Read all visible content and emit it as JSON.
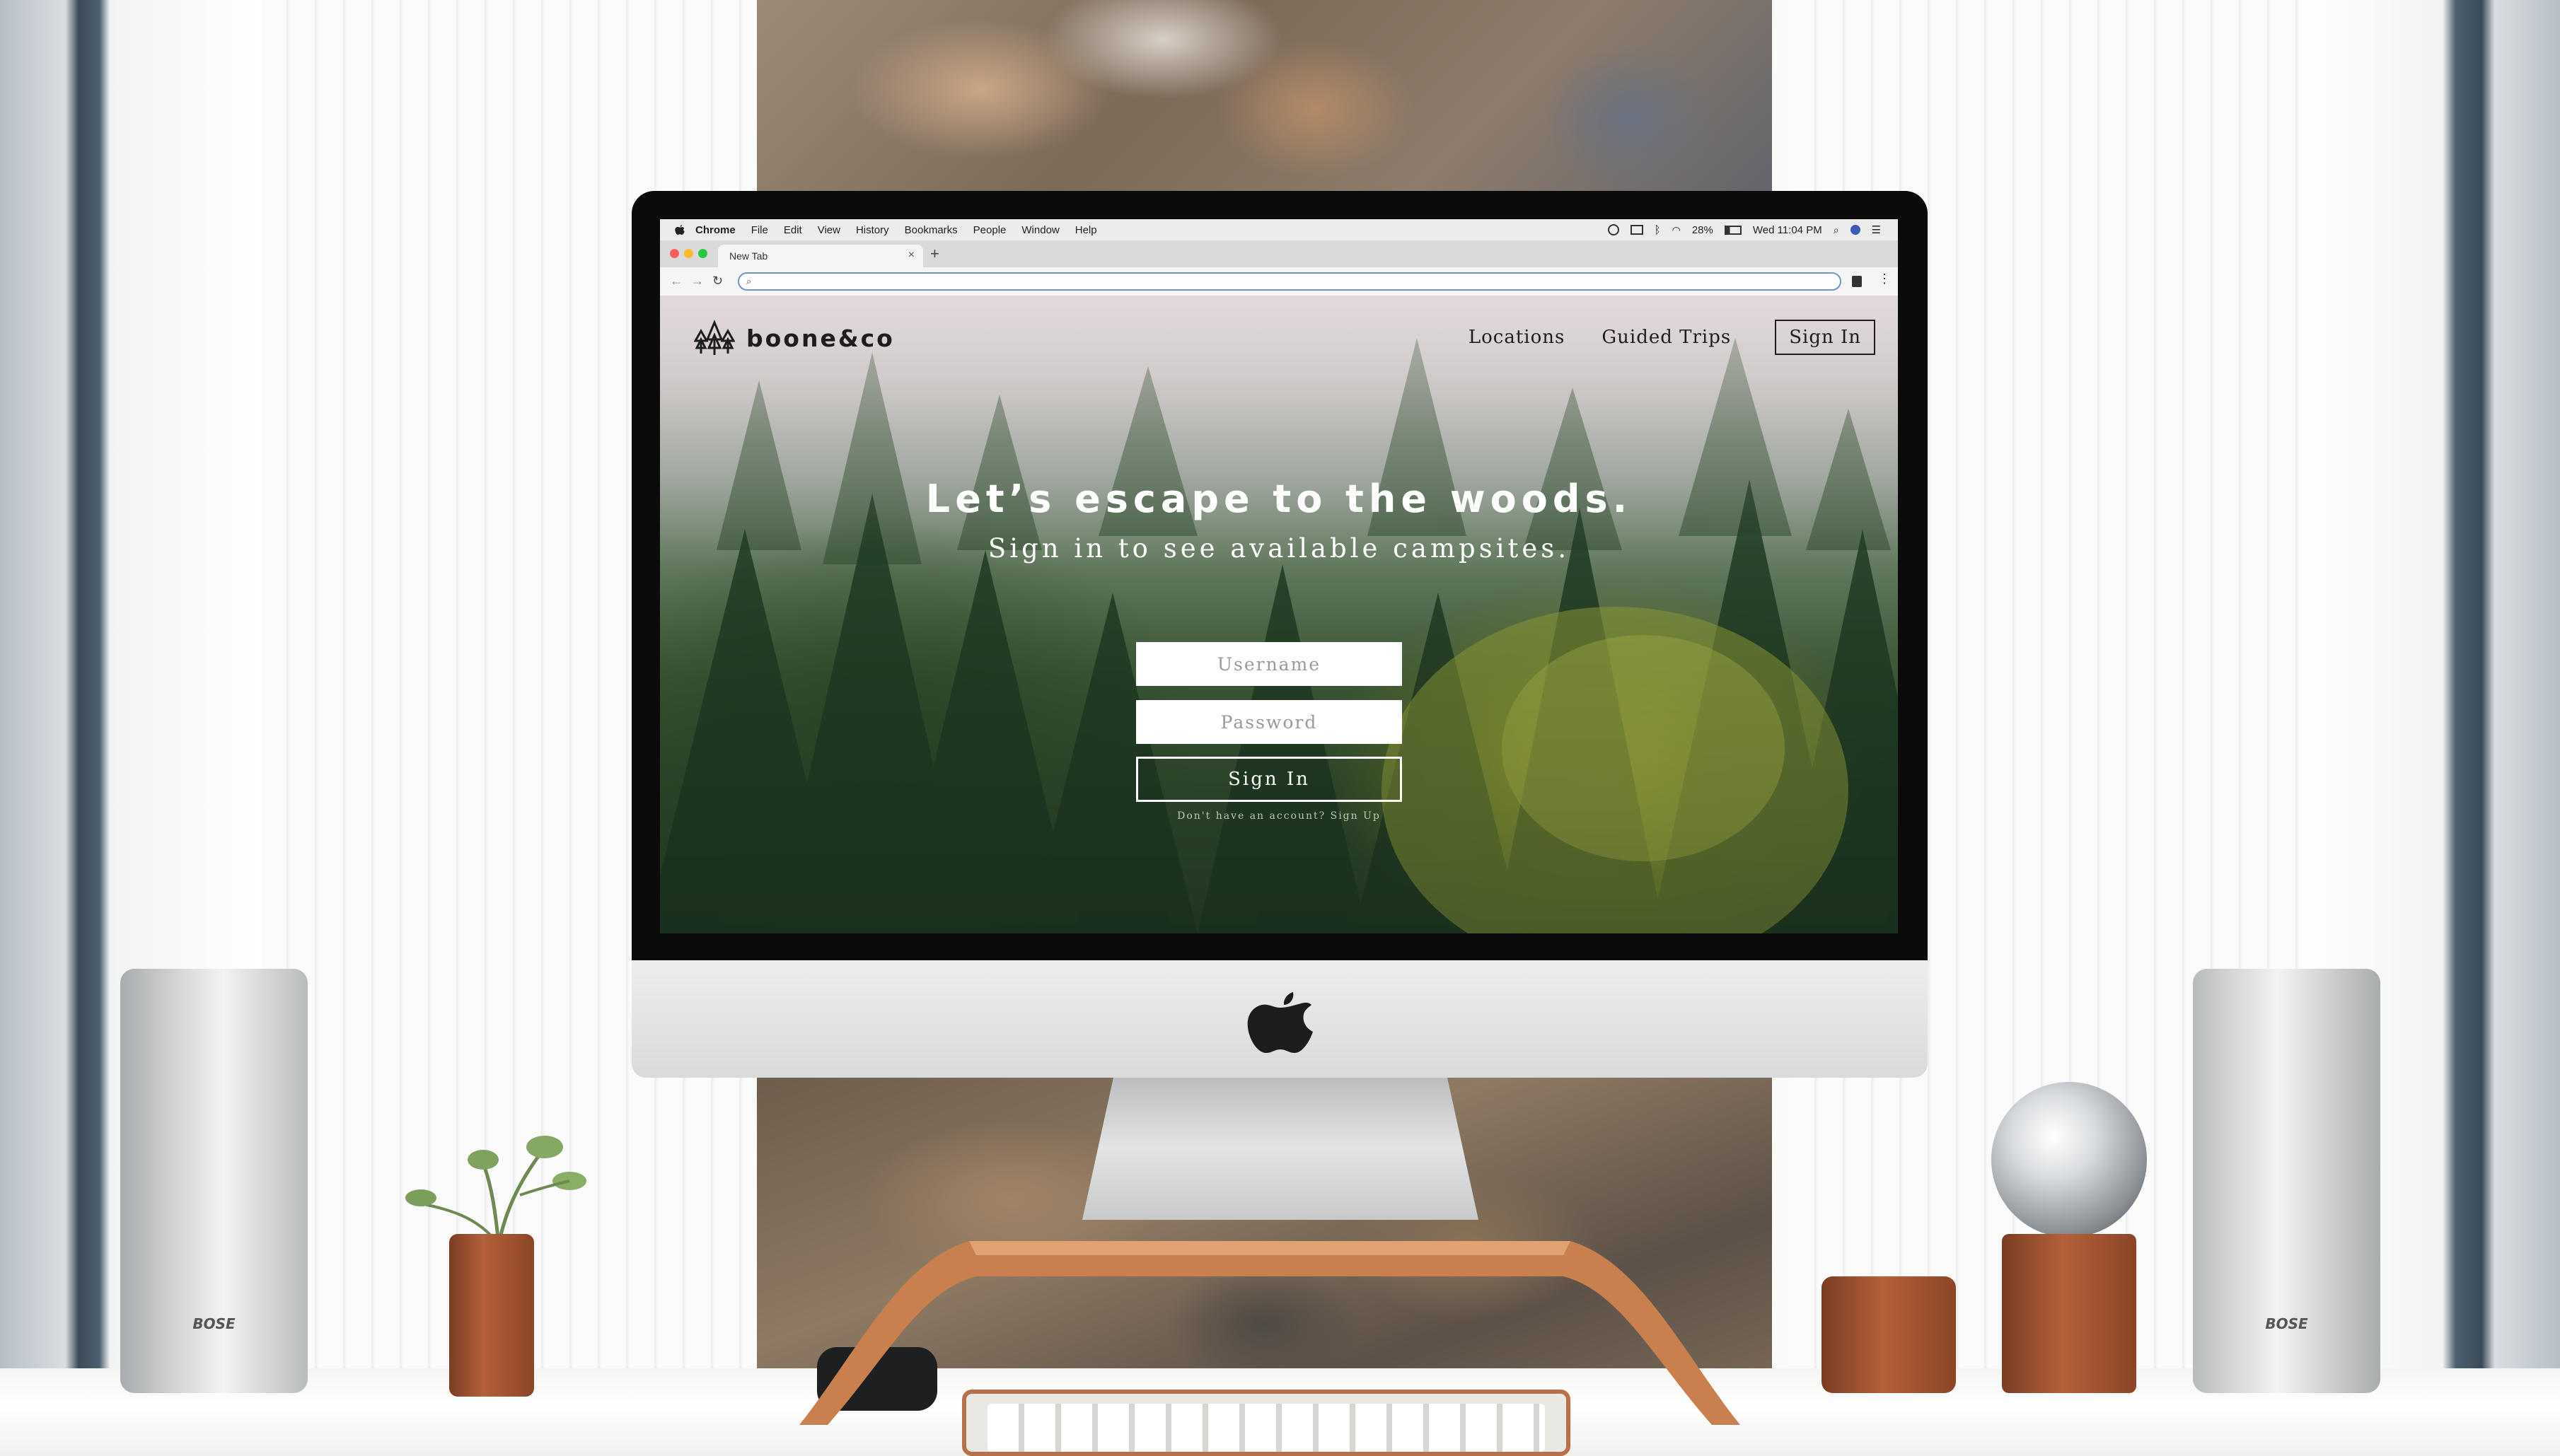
{
  "menubar": {
    "items": [
      "Chrome",
      "File",
      "Edit",
      "View",
      "History",
      "Bookmarks",
      "People",
      "Window",
      "Help"
    ],
    "battery": "28%",
    "clock": "Wed 11:04 PM"
  },
  "browser": {
    "tab_title": "New Tab",
    "tab_close": "×",
    "new_tab": "+",
    "omnibox_value": "",
    "omnibox_icon": "search-icon"
  },
  "site": {
    "brand": "boone&co",
    "nav": {
      "locations": "Locations",
      "guided_trips": "Guided Trips",
      "sign_in": "Sign In"
    },
    "hero": {
      "title": "Let’s escape to the woods.",
      "subtitle": "Sign in to see available campsites."
    },
    "form": {
      "username_placeholder": "Username",
      "password_placeholder": "Password",
      "submit_label": "Sign In",
      "signup_prompt": "Don't have an account? ",
      "signup_link": "Sign Up"
    }
  },
  "hardware": {
    "speaker_brand": "BOSE"
  },
  "colors": {
    "omnibox_focus": "#6f95c9",
    "traffic_red": "#fc5f57",
    "traffic_yellow": "#fdbc2e",
    "traffic_green": "#28c840",
    "brand_text": "#1d1d1d"
  }
}
